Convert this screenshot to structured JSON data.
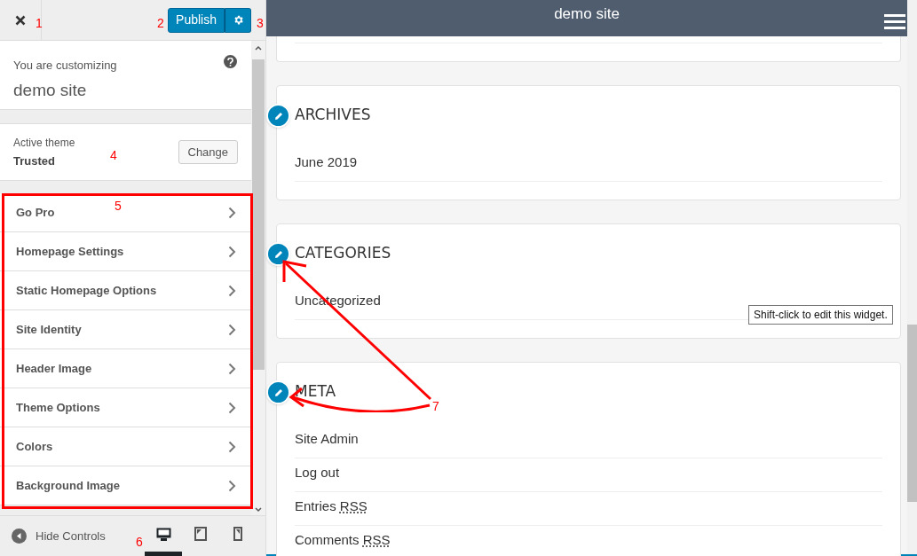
{
  "topbar": {
    "publish": "Publish"
  },
  "info": {
    "label": "You are customizing",
    "site": "demo site"
  },
  "theme": {
    "label": "Active theme",
    "name": "Trusted",
    "button": "Change"
  },
  "sections": [
    {
      "label": "Go Pro"
    },
    {
      "label": "Homepage Settings"
    },
    {
      "label": "Static Homepage Options"
    },
    {
      "label": "Site Identity"
    },
    {
      "label": "Header Image"
    },
    {
      "label": "Theme Options"
    },
    {
      "label": "Colors"
    },
    {
      "label": "Background Image"
    }
  ],
  "footer": {
    "hide_controls": "Hide Controls",
    "devices": [
      {
        "kind": "desktop",
        "selected": true
      },
      {
        "kind": "tablet",
        "selected": false
      },
      {
        "kind": "mobile",
        "selected": false
      }
    ]
  },
  "preview": {
    "site_title": "demo site",
    "widgets": [
      {
        "title": "ARCHIVES",
        "items": [
          {
            "text": "June 2019"
          }
        ]
      },
      {
        "title": "CATEGORIES",
        "items": [
          {
            "text": "Uncategorized"
          }
        ]
      },
      {
        "title": "META",
        "items": [
          {
            "text": "Site Admin"
          },
          {
            "text": "Log out"
          },
          {
            "text": "Entries",
            "abbr": "RSS"
          },
          {
            "text": "Comments",
            "abbr": "RSS"
          }
        ]
      }
    ],
    "tooltip": "Shift-click to edit this widget."
  },
  "annotations": [
    "1",
    "2",
    "3",
    "4",
    "5",
    "6",
    "7"
  ]
}
